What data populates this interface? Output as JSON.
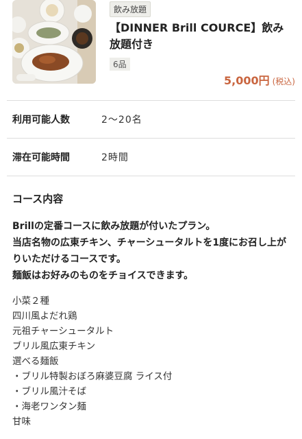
{
  "course": {
    "tag": "飲み放題",
    "title": "【DINNER Brill COURCE】飲み放題付き",
    "count": "6品",
    "price": "5,000円",
    "tax": "(税込)"
  },
  "info": [
    {
      "label": "利用可能人数",
      "value": "2〜20名"
    },
    {
      "label": "滞在可能時間",
      "value": "2時間"
    }
  ],
  "contents": {
    "title": "コース内容",
    "description": [
      "Brillの定番コースに飲み放題が付いたプラン。",
      "当店名物の広東チキン、チャーシュータルトを1度にお召し上がりいただけるコースです。",
      "麺飯はお好みのものをチョイスできます。"
    ],
    "menu": [
      "小菜２種",
      "四川風よだれ鶏",
      "元祖チャーシュータルト",
      "ブリル風広東チキン",
      "選べる麺飯",
      "・ブリル特製おぼろ麻婆豆腐 ライス付",
      "・ブリル風汁そば",
      "・海老ワンタン麺",
      "甘味"
    ]
  }
}
